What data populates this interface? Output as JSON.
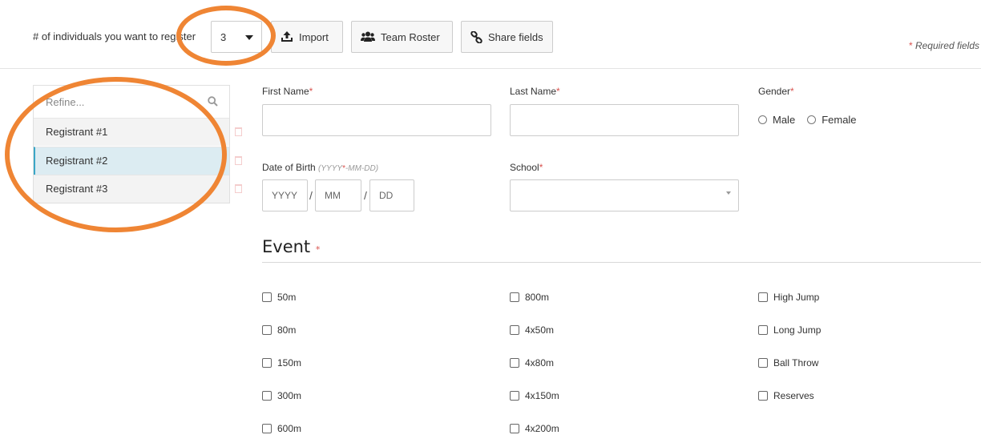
{
  "toolbar": {
    "count_label": "# of individuals you want to register",
    "count_value": "3",
    "import_label": "Import",
    "roster_label": "Team Roster",
    "share_label": "Share fields",
    "required_star": "*",
    "required_note": "Required fields"
  },
  "sidebar": {
    "refine_placeholder": "Refine...",
    "items": [
      {
        "label": "Registrant #1"
      },
      {
        "label": "Registrant #2"
      },
      {
        "label": "Registrant #3"
      }
    ]
  },
  "form": {
    "first_name_label": "First Name",
    "last_name_label": "Last Name",
    "gender_label": "Gender",
    "gender_options": [
      "Male",
      "Female"
    ],
    "dob_label": "Date of Birth",
    "dob_hint_a": "(YYYY",
    "dob_hint_b": "-MM-DD)",
    "dob_year_placeholder": "YYYY",
    "dob_month_placeholder": "MM",
    "dob_day_placeholder": "DD",
    "dob_sep": "/",
    "school_label": "School",
    "star": "*"
  },
  "event": {
    "title": "Event",
    "star": "*",
    "columns": [
      [
        "50m",
        "80m",
        "150m",
        "300m",
        "600m"
      ],
      [
        "800m",
        "4x50m",
        "4x80m",
        "4x150m",
        "4x200m"
      ],
      [
        "High Jump",
        "Long Jump",
        "Ball Throw",
        "Reserves"
      ]
    ]
  },
  "colors": {
    "accent": "#3aa6c6",
    "active_row": "#dcecf2",
    "required": "#d9534f",
    "annotation_ring": "#ef8534"
  }
}
